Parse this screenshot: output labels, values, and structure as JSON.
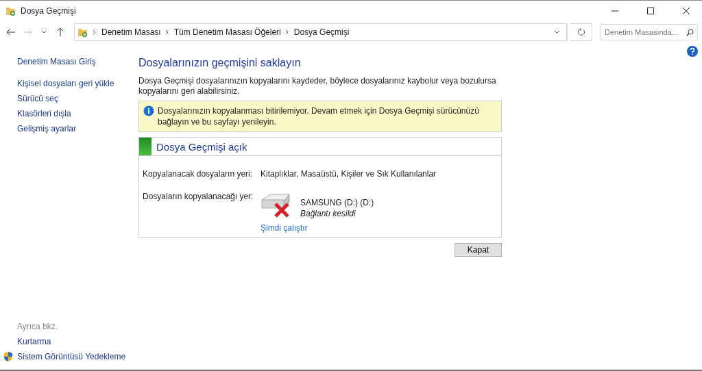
{
  "window": {
    "title": "Dosya Geçmişi"
  },
  "nav": {
    "breadcrumbs": [
      "Denetim Masası",
      "Tüm Denetim Masası Öğeleri",
      "Dosya Geçmişi"
    ],
    "search": {
      "placeholder": "Denetim Masasında..."
    }
  },
  "sidebar": {
    "items": [
      "Denetim Masası Giriş",
      "Kişisel dosyaları geri yükle",
      "Sürücü seç",
      "Klasörleri dışla",
      "Gelişmiş ayarlar"
    ],
    "see_also": {
      "heading": "Ayrıca bkz.",
      "links": [
        {
          "label": "Kurtarma",
          "kind": "plain"
        },
        {
          "label": "Sistem Görüntüsü Yedekleme",
          "kind": "shield"
        }
      ]
    }
  },
  "main": {
    "heading": "Dosyalarınızın geçmişini saklayın",
    "description": "Dosya Geçmişi dosyalarınızın kopyalarını kaydeder, böylece dosyalarınız kaybolur veya bozulursa kopyalarını geri alabilirsiniz.",
    "banner": "Dosyalarınızın kopyalanması bitirilemiyor. Devam etmek için Dosya Geçmişi sürücünüzü bağlayın ve bu sayfayı yenileyin.",
    "panel": {
      "title": "Dosya Geçmişi açık",
      "source_label": "Kopyalanacak dosyaların yeri:",
      "source_value": "Kitaplıklar, Masaüstü, Kişiler ve Sık Kullanılanlar",
      "target_label": "Dosyaların kopyalanacağı yer:",
      "drive_name": "SAMSUNG (D:) (D:)",
      "drive_status": "Bağlantı kesildi",
      "action": "Şimdi çalıştır"
    },
    "close_button": "Kapat"
  }
}
